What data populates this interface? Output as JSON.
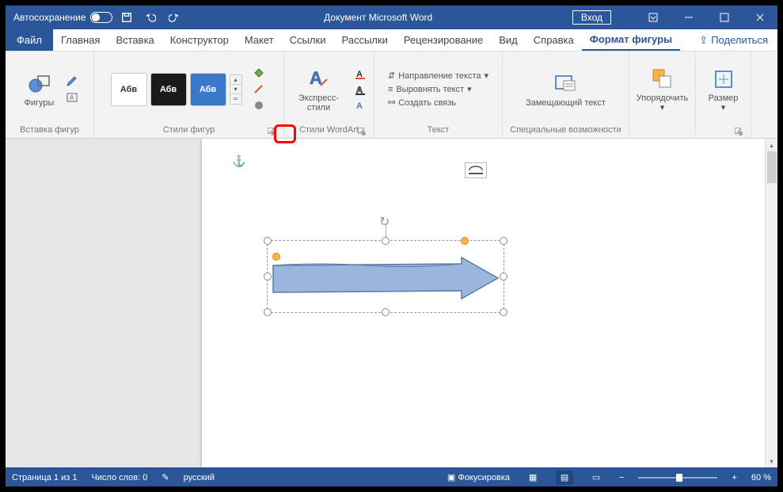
{
  "titlebar": {
    "autosave": "Автосохранение",
    "doc_title": "Документ Microsoft Word",
    "signin": "Вход"
  },
  "tabs": {
    "file": "Файл",
    "items": [
      "Главная",
      "Вставка",
      "Конструктор",
      "Макет",
      "Ссылки",
      "Рассылки",
      "Рецензирование",
      "Вид",
      "Справка"
    ],
    "active": "Формат фигуры",
    "share": "Поделиться"
  },
  "ribbon": {
    "g_insert": {
      "shapes": "Фигуры",
      "label": "Вставка фигур"
    },
    "g_styles": {
      "thumb_text": "Абв",
      "label": "Стили фигур"
    },
    "g_wordart": {
      "express": "Экспресс-стили",
      "label": "Стили WordArt"
    },
    "g_text": {
      "direction": "Направление текста",
      "align": "Выровнять текст",
      "link": "Создать связь",
      "label": "Текст"
    },
    "g_access": {
      "alt": "Замещающий текст",
      "label": "Специальные возможности"
    },
    "g_arrange": {
      "arrange": "Упорядочить",
      "label": ""
    },
    "g_size": {
      "size": "Размер",
      "label": ""
    }
  },
  "statusbar": {
    "page": "Страница 1 из 1",
    "words": "Число слов: 0",
    "lang": "русский",
    "focus": "Фокусировка",
    "zoom": "60 %"
  }
}
